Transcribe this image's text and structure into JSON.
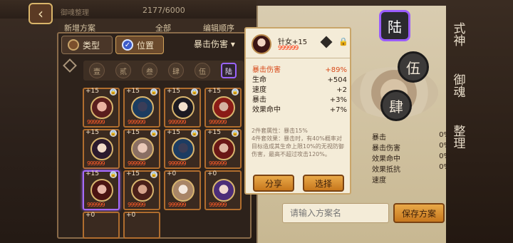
{
  "topbar": {
    "back_icon": "back-arrow-icon",
    "counter": "2177/6000",
    "label": "御魂整理"
  },
  "tabs": {
    "new_plan": "新增方案",
    "all": "全部",
    "edit_order": "编辑顺序"
  },
  "filter": {
    "type_label": "类型",
    "position_label": "位置",
    "sort_label": "暴击伤害",
    "dropdown_icon": "chevron-down-icon"
  },
  "position_slots": [
    "壹",
    "贰",
    "叁",
    "肆",
    "伍",
    "陆"
  ],
  "cards": [
    {
      "level": "+15",
      "stars": "999999"
    },
    {
      "level": "+15",
      "stars": "999999"
    },
    {
      "level": "+15",
      "stars": "999999"
    },
    {
      "level": "+15",
      "stars": "999999"
    },
    {
      "level": "+15",
      "stars": "999999"
    },
    {
      "level": "+15",
      "stars": "999999"
    },
    {
      "level": "+15",
      "stars": "999999"
    },
    {
      "level": "+15",
      "stars": "999999"
    },
    {
      "level": "+15",
      "stars": "999999"
    },
    {
      "level": "+15",
      "stars": "999999"
    },
    {
      "level": "+0",
      "stars": "999999"
    },
    {
      "level": "+0",
      "stars": "999999"
    },
    {
      "level": "+0",
      "stars": "999999"
    },
    {
      "level": "+0",
      "stars": "999999"
    }
  ],
  "tooltip": {
    "name": "针女+15",
    "stars": "999999",
    "stats": [
      {
        "label": "暴击伤害",
        "value": "+89%"
      },
      {
        "label": "生命",
        "value": "+504"
      },
      {
        "label": "速度",
        "value": "+2"
      },
      {
        "label": "暴击",
        "value": "+3%"
      },
      {
        "label": "效果命中",
        "value": "+7%"
      }
    ],
    "set_desc": "2件套属性：暴击15%",
    "set_desc2": "4件套效果：暴击时，有40%概率对目标造成其生命上限10%的无视防御伤害，最高不超过攻击120%。",
    "share_button": "分享",
    "select_button": "选择"
  },
  "orbs": {
    "six": "陆",
    "five": "伍",
    "four": "肆"
  },
  "vertical_tabs": [
    "式神",
    "御魂",
    "整理"
  ],
  "right_stats": [
    {
      "label": "暴击",
      "value": "0%"
    },
    {
      "label": "暴击伤害",
      "value": "0%"
    },
    {
      "label": "效果命中",
      "value": "0%"
    },
    {
      "label": "效果抵抗",
      "value": "0%"
    },
    {
      "label": "速度",
      "value": "0"
    }
  ],
  "plan_input": {
    "placeholder": "请输入方案名"
  },
  "save_button": "保存方案"
}
